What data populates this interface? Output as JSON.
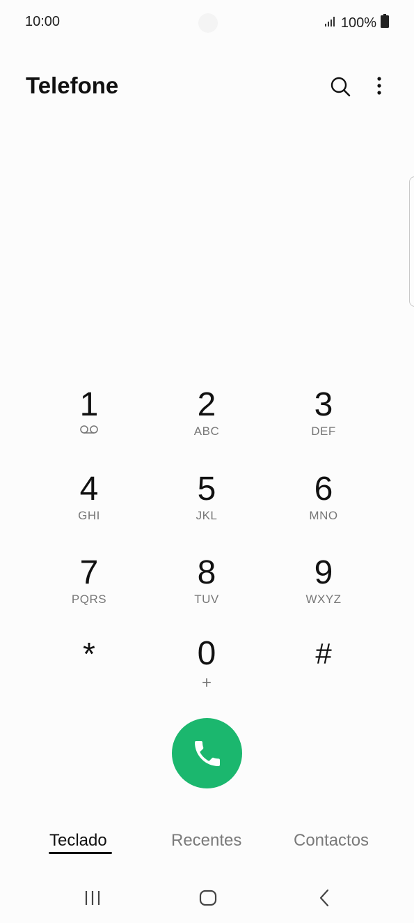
{
  "status_bar": {
    "time": "10:00",
    "battery": "100%",
    "signal_icon": "signal-icon",
    "battery_icon": "battery-icon"
  },
  "header": {
    "title": "Telefone",
    "search_icon": "search-icon",
    "more_icon": "more-options-icon"
  },
  "keypad": {
    "keys": [
      {
        "digit": "1",
        "letters": "",
        "icon": "voicemail-icon"
      },
      {
        "digit": "2",
        "letters": "ABC"
      },
      {
        "digit": "3",
        "letters": "DEF"
      },
      {
        "digit": "4",
        "letters": "GHI"
      },
      {
        "digit": "5",
        "letters": "JKL"
      },
      {
        "digit": "6",
        "letters": "MNO"
      },
      {
        "digit": "7",
        "letters": "PQRS"
      },
      {
        "digit": "8",
        "letters": "TUV"
      },
      {
        "digit": "9",
        "letters": "WXYZ"
      },
      {
        "digit": "*",
        "letters": ""
      },
      {
        "digit": "0",
        "letters": "+"
      },
      {
        "digit": "#",
        "letters": ""
      }
    ]
  },
  "call_button": {
    "icon": "phone-icon",
    "color": "#1bb76e"
  },
  "tabs": [
    {
      "label": "Teclado",
      "active": true
    },
    {
      "label": "Recentes",
      "active": false
    },
    {
      "label": "Contactos",
      "active": false
    }
  ],
  "nav_bar": {
    "recents_icon": "recent-apps-icon",
    "home_icon": "home-icon",
    "back_icon": "back-icon"
  }
}
